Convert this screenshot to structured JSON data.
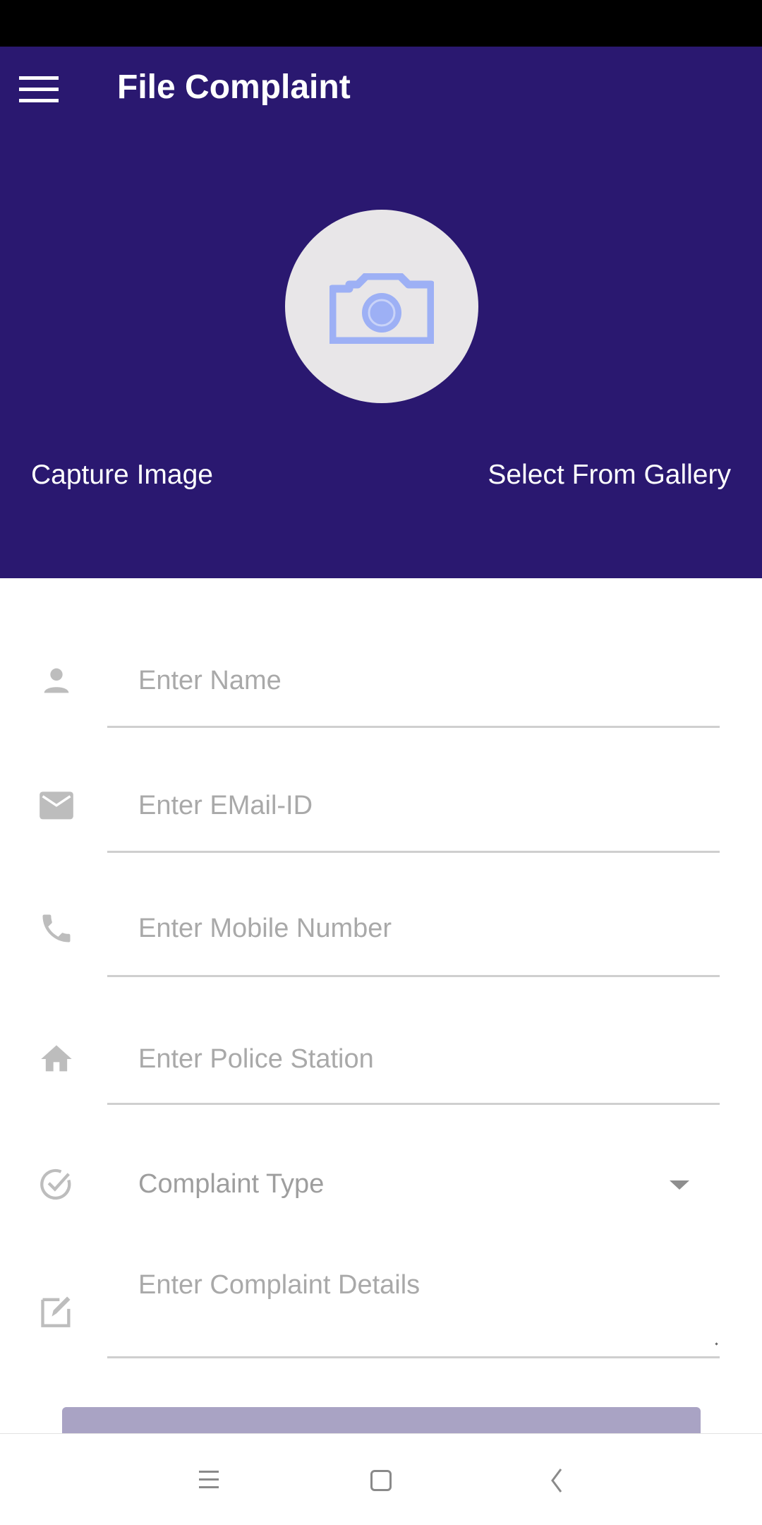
{
  "header": {
    "title": "File Complaint",
    "menu_icon": "hamburger-menu-icon",
    "camera_icon": "camera-icon",
    "capture_label": "Capture Image",
    "gallery_label": "Select From Gallery"
  },
  "form": {
    "name": {
      "icon": "person-icon",
      "placeholder": "Enter Name",
      "value": ""
    },
    "email": {
      "icon": "email-icon",
      "placeholder": "Enter EMail-ID",
      "value": ""
    },
    "mobile": {
      "icon": "phone-icon",
      "placeholder": "Enter Mobile Number",
      "value": ""
    },
    "police_station": {
      "icon": "home-icon",
      "placeholder": "Enter Police Station",
      "value": ""
    },
    "complaint_type": {
      "icon": "check-circle-icon",
      "selected": "Complaint Type"
    },
    "details": {
      "icon": "edit-icon",
      "placeholder": "Enter Complaint Details",
      "value": ""
    }
  },
  "submit": {
    "label": ""
  },
  "nav": {
    "recents_icon": "recents-icon",
    "home_icon": "home-button-icon",
    "back_icon": "back-icon"
  },
  "colors": {
    "header_bg": "#2A1870",
    "circle_bg": "#E8E6E8",
    "camera_icon": "#9DB0F5",
    "icon_gray": "#BDBDBD",
    "placeholder": "#A9A9A9",
    "button_bg": "#A9A3C4"
  }
}
